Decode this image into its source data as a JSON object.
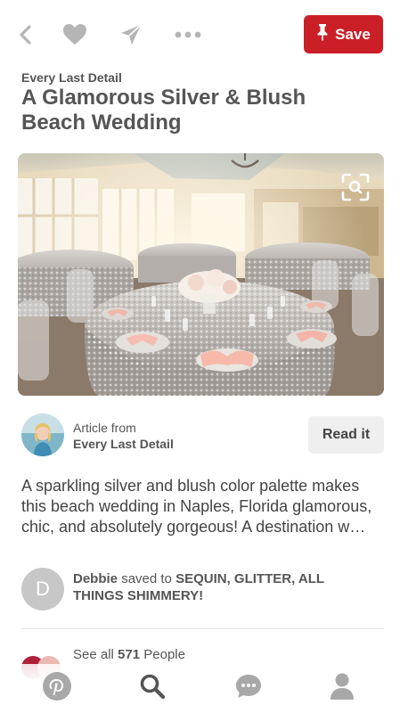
{
  "toolbar": {
    "save_label": "Save",
    "icons": [
      "back-icon",
      "heart-icon",
      "send-icon",
      "more-icon",
      "pin-icon"
    ],
    "accent_color": "#cb1f27"
  },
  "pin": {
    "source": "Every Last Detail",
    "title": "A Glamorous Silver & Blush Beach Wedding"
  },
  "article": {
    "from_label": "Article from",
    "source_name": "Every Last Detail",
    "read_label": "Read it"
  },
  "description": "A sparkling silver and blush color palette makes this beach wedding in Naples, Florida glamorous, chic, and absolutely gorgeous! A destination w…",
  "saved": {
    "avatar_letter": "D",
    "user": "Debbie",
    "action": "saved to",
    "board": "SEQUIN, GLITTER, ALL THINGS SHIMMERY!"
  },
  "people": {
    "prefix": "See all",
    "count": "571",
    "suffix": "People"
  },
  "bottom_nav": {
    "tabs": [
      "pinterest-icon",
      "search-icon",
      "chat-icon",
      "profile-icon"
    ]
  }
}
